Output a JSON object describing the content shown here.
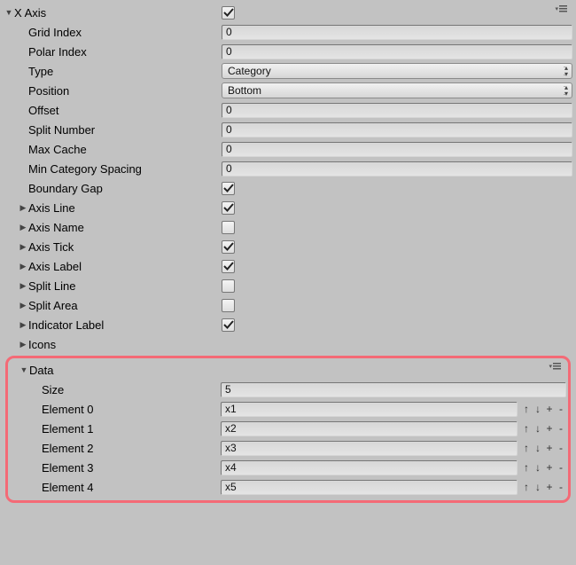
{
  "header": {
    "title": "X Axis",
    "checked": true
  },
  "fields": {
    "gridIndex": {
      "label": "Grid Index",
      "value": "0"
    },
    "polarIndex": {
      "label": "Polar Index",
      "value": "0"
    },
    "type": {
      "label": "Type",
      "value": "Category"
    },
    "position": {
      "label": "Position",
      "value": "Bottom"
    },
    "offset": {
      "label": "Offset",
      "value": "0"
    },
    "splitNumber": {
      "label": "Split Number",
      "value": "0"
    },
    "maxCache": {
      "label": "Max Cache",
      "value": "0"
    },
    "minCatSpace": {
      "label": "Min Category Spacing",
      "value": "0"
    },
    "boundaryGap": {
      "label": "Boundary Gap",
      "checked": true
    }
  },
  "subFoldouts": {
    "axisLine": {
      "label": "Axis Line",
      "checked": true
    },
    "axisName": {
      "label": "Axis Name",
      "checked": false
    },
    "axisTick": {
      "label": "Axis Tick",
      "checked": true
    },
    "axisLabel": {
      "label": "Axis Label",
      "checked": true
    },
    "splitLine": {
      "label": "Split Line",
      "checked": false
    },
    "splitArea": {
      "label": "Split Area",
      "checked": false
    },
    "indicatorLabel": {
      "label": "Indicator Label",
      "checked": true
    },
    "icons": {
      "label": "Icons"
    }
  },
  "data": {
    "label": "Data",
    "sizeLabel": "Size",
    "size": "5",
    "elements": [
      {
        "label": "Element 0",
        "value": "x1"
      },
      {
        "label": "Element 1",
        "value": "x2"
      },
      {
        "label": "Element 2",
        "value": "x3"
      },
      {
        "label": "Element 3",
        "value": "x4"
      },
      {
        "label": "Element 4",
        "value": "x5"
      }
    ],
    "buttons": {
      "up": "↑",
      "down": "↓",
      "add": "+",
      "remove": "-"
    }
  }
}
